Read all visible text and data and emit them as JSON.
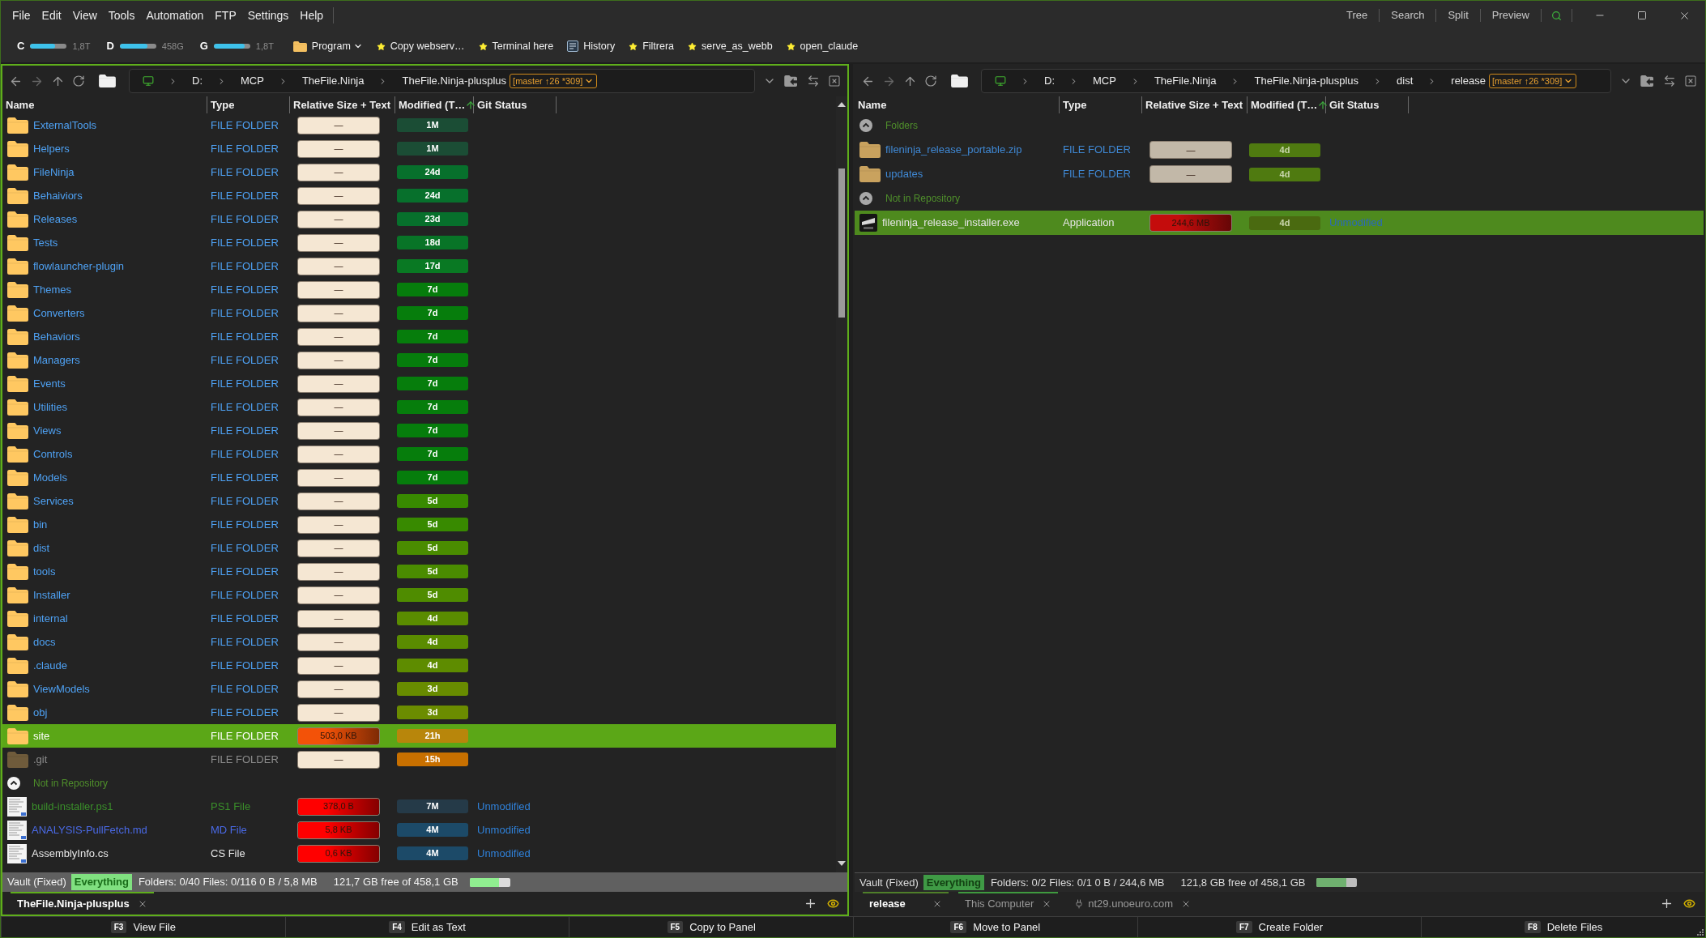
{
  "menu": [
    "File",
    "Edit",
    "View",
    "Tools",
    "Automation",
    "FTP",
    "Settings",
    "Help"
  ],
  "view_buttons": [
    "Tree",
    "Search",
    "Split",
    "Preview"
  ],
  "drives": [
    {
      "letter": "C",
      "level": 0.68,
      "capacity": "1,8T"
    },
    {
      "letter": "D",
      "level": 0.77,
      "capacity": "458G"
    },
    {
      "letter": "G",
      "level": 0.85,
      "capacity": "1,8T"
    }
  ],
  "quick_actions": [
    {
      "kind": "folder",
      "label": "Program",
      "dropdown": true
    },
    {
      "kind": "star",
      "label": "Copy webserv…",
      "dropdown": false
    },
    {
      "kind": "star",
      "label": "Terminal here",
      "dropdown": false
    },
    {
      "kind": "window",
      "label": "History",
      "dropdown": false
    },
    {
      "kind": "star",
      "label": "Filtrera",
      "dropdown": false
    },
    {
      "kind": "star",
      "label": "serve_as_webb",
      "dropdown": false
    },
    {
      "kind": "star",
      "label": "open_claude",
      "dropdown": false
    }
  ],
  "panels": [
    {
      "active": true,
      "scrollable": true,
      "breadcrumb": [
        "D:",
        "MCP",
        "TheFile.Ninja",
        "TheFile.Ninja-plusplus"
      ],
      "git_badge": "[master ↑26 *309]",
      "columns": [
        {
          "label": "Name",
          "sorted": false
        },
        {
          "label": "Type",
          "sorted": false
        },
        {
          "label": "Relative Size + Text",
          "sorted": false
        },
        {
          "label": "Modified (T…",
          "sorted": true
        },
        {
          "label": "Git Status",
          "sorted": false
        }
      ],
      "rows": [
        {
          "kind": "folder",
          "name": "ExternalTools",
          "type": "FILE FOLDER",
          "color": "#4ea1f3",
          "size": {
            "text": "—",
            "color": "#f5e7d3",
            "gradient": false
          },
          "modified": {
            "text": "1M",
            "color": "#1b4d35"
          },
          "selected": false,
          "hidden": false
        },
        {
          "kind": "folder",
          "name": "Helpers",
          "type": "FILE FOLDER",
          "color": "#4ea1f3",
          "size": {
            "text": "—",
            "color": "#f5e7d3",
            "gradient": false
          },
          "modified": {
            "text": "1M",
            "color": "#1b4d35"
          },
          "selected": false,
          "hidden": false
        },
        {
          "kind": "folder",
          "name": "FileNinja",
          "type": "FILE FOLDER",
          "color": "#4ea1f3",
          "size": {
            "text": "—",
            "color": "#f5e7d3",
            "gradient": false
          },
          "modified": {
            "text": "24d",
            "color": "#07702c"
          },
          "selected": false,
          "hidden": false
        },
        {
          "kind": "folder",
          "name": "Behaiviors",
          "type": "FILE FOLDER",
          "color": "#4ea1f3",
          "size": {
            "text": "—",
            "color": "#f5e7d3",
            "gradient": false
          },
          "modified": {
            "text": "24d",
            "color": "#07702c"
          },
          "selected": false,
          "hidden": false
        },
        {
          "kind": "folder",
          "name": "Releases",
          "type": "FILE FOLDER",
          "color": "#4ea1f3",
          "size": {
            "text": "—",
            "color": "#f5e7d3",
            "gradient": false
          },
          "modified": {
            "text": "23d",
            "color": "#07702c"
          },
          "selected": false,
          "hidden": false
        },
        {
          "kind": "folder",
          "name": "Tests",
          "type": "FILE FOLDER",
          "color": "#4ea1f3",
          "size": {
            "text": "—",
            "color": "#f5e7d3",
            "gradient": false
          },
          "modified": {
            "text": "18d",
            "color": "#087427"
          },
          "selected": false,
          "hidden": false
        },
        {
          "kind": "folder",
          "name": "flowlauncher-plugin",
          "type": "FILE FOLDER",
          "color": "#4ea1f3",
          "size": {
            "text": "—",
            "color": "#f5e7d3",
            "gradient": false
          },
          "modified": {
            "text": "17d",
            "color": "#097923"
          },
          "selected": false,
          "hidden": false
        },
        {
          "kind": "folder",
          "name": "Themes",
          "type": "FILE FOLDER",
          "color": "#4ea1f3",
          "size": {
            "text": "—",
            "color": "#f5e7d3",
            "gradient": false
          },
          "modified": {
            "text": "7d",
            "color": "#067d0c"
          },
          "selected": false,
          "hidden": false
        },
        {
          "kind": "folder",
          "name": "Converters",
          "type": "FILE FOLDER",
          "color": "#4ea1f3",
          "size": {
            "text": "—",
            "color": "#f5e7d3",
            "gradient": false
          },
          "modified": {
            "text": "7d",
            "color": "#067d0c"
          },
          "selected": false,
          "hidden": false
        },
        {
          "kind": "folder",
          "name": "Behaviors",
          "type": "FILE FOLDER",
          "color": "#4ea1f3",
          "size": {
            "text": "—",
            "color": "#f5e7d3",
            "gradient": false
          },
          "modified": {
            "text": "7d",
            "color": "#067d0c"
          },
          "selected": false,
          "hidden": false
        },
        {
          "kind": "folder",
          "name": "Managers",
          "type": "FILE FOLDER",
          "color": "#4ea1f3",
          "size": {
            "text": "—",
            "color": "#f5e7d3",
            "gradient": false
          },
          "modified": {
            "text": "7d",
            "color": "#067d0c"
          },
          "selected": false,
          "hidden": false
        },
        {
          "kind": "folder",
          "name": "Events",
          "type": "FILE FOLDER",
          "color": "#4ea1f3",
          "size": {
            "text": "—",
            "color": "#f5e7d3",
            "gradient": false
          },
          "modified": {
            "text": "7d",
            "color": "#067d0c"
          },
          "selected": false,
          "hidden": false
        },
        {
          "kind": "folder",
          "name": "Utilities",
          "type": "FILE FOLDER",
          "color": "#4ea1f3",
          "size": {
            "text": "—",
            "color": "#f5e7d3",
            "gradient": false
          },
          "modified": {
            "text": "7d",
            "color": "#067d0c"
          },
          "selected": false,
          "hidden": false
        },
        {
          "kind": "folder",
          "name": "Views",
          "type": "FILE FOLDER",
          "color": "#4ea1f3",
          "size": {
            "text": "—",
            "color": "#f5e7d3",
            "gradient": false
          },
          "modified": {
            "text": "7d",
            "color": "#067d0c"
          },
          "selected": false,
          "hidden": false
        },
        {
          "kind": "folder",
          "name": "Controls",
          "type": "FILE FOLDER",
          "color": "#4ea1f3",
          "size": {
            "text": "—",
            "color": "#f5e7d3",
            "gradient": false
          },
          "modified": {
            "text": "7d",
            "color": "#067d0c"
          },
          "selected": false,
          "hidden": false
        },
        {
          "kind": "folder",
          "name": "Models",
          "type": "FILE FOLDER",
          "color": "#4ea1f3",
          "size": {
            "text": "—",
            "color": "#f5e7d3",
            "gradient": false
          },
          "modified": {
            "text": "7d",
            "color": "#067d0c"
          },
          "selected": false,
          "hidden": false
        },
        {
          "kind": "folder",
          "name": "Services",
          "type": "FILE FOLDER",
          "color": "#4ea1f3",
          "size": {
            "text": "—",
            "color": "#f5e7d3",
            "gradient": false
          },
          "modified": {
            "text": "5d",
            "color": "#388a00"
          },
          "selected": false,
          "hidden": false
        },
        {
          "kind": "folder",
          "name": "bin",
          "type": "FILE FOLDER",
          "color": "#4ea1f3",
          "size": {
            "text": "—",
            "color": "#f5e7d3",
            "gradient": false
          },
          "modified": {
            "text": "5d",
            "color": "#388a00"
          },
          "selected": false,
          "hidden": false
        },
        {
          "kind": "folder",
          "name": "dist",
          "type": "FILE FOLDER",
          "color": "#4ea1f3",
          "size": {
            "text": "—",
            "color": "#f5e7d3",
            "gradient": false
          },
          "modified": {
            "text": "5d",
            "color": "#4a8c00"
          },
          "selected": false,
          "hidden": false
        },
        {
          "kind": "folder",
          "name": "tools",
          "type": "FILE FOLDER",
          "color": "#4ea1f3",
          "size": {
            "text": "—",
            "color": "#f5e7d3",
            "gradient": false
          },
          "modified": {
            "text": "5d",
            "color": "#4a8c00"
          },
          "selected": false,
          "hidden": false
        },
        {
          "kind": "folder",
          "name": "Installer",
          "type": "FILE FOLDER",
          "color": "#4ea1f3",
          "size": {
            "text": "—",
            "color": "#f5e7d3",
            "gradient": false
          },
          "modified": {
            "text": "5d",
            "color": "#4f8c00"
          },
          "selected": false,
          "hidden": false
        },
        {
          "kind": "folder",
          "name": "internal",
          "type": "FILE FOLDER",
          "color": "#4ea1f3",
          "size": {
            "text": "—",
            "color": "#f5e7d3",
            "gradient": false
          },
          "modified": {
            "text": "4d",
            "color": "#5a8c00"
          },
          "selected": false,
          "hidden": false
        },
        {
          "kind": "folder",
          "name": "docs",
          "type": "FILE FOLDER",
          "color": "#4ea1f3",
          "size": {
            "text": "—",
            "color": "#f5e7d3",
            "gradient": false
          },
          "modified": {
            "text": "4d",
            "color": "#5a8c00"
          },
          "selected": false,
          "hidden": false
        },
        {
          "kind": "folder",
          "name": ".claude",
          "type": "FILE FOLDER",
          "color": "#4ea1f3",
          "size": {
            "text": "—",
            "color": "#f5e7d3",
            "gradient": false
          },
          "modified": {
            "text": "4d",
            "color": "#5e8c00"
          },
          "selected": false,
          "hidden": false
        },
        {
          "kind": "folder",
          "name": "ViewModels",
          "type": "FILE FOLDER",
          "color": "#4ea1f3",
          "size": {
            "text": "—",
            "color": "#f5e7d3",
            "gradient": false
          },
          "modified": {
            "text": "3d",
            "color": "#688c00"
          },
          "selected": false,
          "hidden": false
        },
        {
          "kind": "folder",
          "name": "obj",
          "type": "FILE FOLDER",
          "color": "#4ea1f3",
          "size": {
            "text": "—",
            "color": "#f5e7d3",
            "gradient": false
          },
          "modified": {
            "text": "3d",
            "color": "#6b8c00"
          },
          "selected": false,
          "hidden": false
        },
        {
          "kind": "folder",
          "name": "site",
          "type": "FILE FOLDER",
          "color": "#ffffff",
          "size": {
            "text": "503,0 KB",
            "color": "#f35208",
            "gradient": true
          },
          "modified": {
            "text": "21h",
            "color": "#b8860b"
          },
          "selected": true,
          "hidden": false
        },
        {
          "kind": "folder",
          "name": ".git",
          "type": "FILE FOLDER",
          "color": "#8c8c8c",
          "size": {
            "text": "—",
            "color": "#f5e7d3",
            "gradient": false
          },
          "modified": {
            "text": "15h",
            "color": "#c87000"
          },
          "selected": false,
          "hidden": true
        },
        {
          "kind": "group",
          "label": "Not in Repository",
          "expanded": true
        },
        {
          "kind": "file",
          "name": "build-installer.ps1",
          "type": "PS1 File",
          "color": "#3a8f2a",
          "size": {
            "text": "378,0 B",
            "color": "#ff0000",
            "gradient": true
          },
          "modified": {
            "text": "7M",
            "color": "#253a48"
          },
          "git": "Unmodified",
          "selected": false,
          "hidden": false
        },
        {
          "kind": "file",
          "name": "ANALYSIS-PullFetch.md",
          "type": "MD File",
          "color": "#4a6ae8",
          "size": {
            "text": "5,8 KB",
            "color": "#ff0000",
            "gradient": true
          },
          "modified": {
            "text": "4M",
            "color": "#1c4a68"
          },
          "git": "Unmodified",
          "selected": false,
          "hidden": false
        },
        {
          "kind": "file",
          "name": "AssemblyInfo.cs",
          "type": "CS File",
          "color": "#e8e8e8",
          "size": {
            "text": "0,6 KB",
            "color": "#ff0000",
            "gradient": true
          },
          "modified": {
            "text": "4M",
            "color": "#1c4a68"
          },
          "git": "Unmodified",
          "selected": false,
          "hidden": false
        }
      ],
      "status": {
        "drive": "Vault (Fixed)",
        "index": "Everything",
        "summary": "Folders: 0/40 Files: 0/116 0 B / 5,8 MB",
        "free": "121,7 GB free of 458,1 GB",
        "level": 0.73
      },
      "tabs": [
        {
          "kind": "local",
          "label": "TheFile.Ninja-plusplus",
          "selected": true,
          "color": "#5fae1b"
        }
      ]
    },
    {
      "active": false,
      "scrollable": false,
      "breadcrumb": [
        "D:",
        "MCP",
        "TheFile.Ninja",
        "TheFile.Ninja-plusplus",
        "dist",
        "release"
      ],
      "git_badge": "[master ↑26 *309]",
      "columns": [
        {
          "label": "Name",
          "sorted": false
        },
        {
          "label": "Type",
          "sorted": false
        },
        {
          "label": "Relative Size + Text",
          "sorted": false
        },
        {
          "label": "Modified (T…",
          "sorted": true
        },
        {
          "label": "Git Status",
          "sorted": false
        }
      ],
      "rows": [
        {
          "kind": "group",
          "label": "Folders",
          "expanded": true
        },
        {
          "kind": "folder",
          "name": "fileninja_release_portable.zip",
          "type": "FILE FOLDER",
          "color": "#3f88d4",
          "size": {
            "text": "—",
            "color": "#c2b8a8",
            "gradient": false
          },
          "modified": {
            "text": "4d",
            "color": "#4f7a10"
          },
          "selected": false,
          "hidden": false
        },
        {
          "kind": "folder",
          "name": "updates",
          "type": "FILE FOLDER",
          "color": "#3f88d4",
          "size": {
            "text": "—",
            "color": "#c2b8a8",
            "gradient": false
          },
          "modified": {
            "text": "4d",
            "color": "#4f7a10"
          },
          "selected": false,
          "hidden": false
        },
        {
          "kind": "group",
          "label": "Not in Repository",
          "expanded": true
        },
        {
          "kind": "app",
          "name": "fileninja_release_installer.exe",
          "type": "Application",
          "color": "#e4e4e4",
          "size": {
            "text": "244,6 MB",
            "color": "#c40c0c",
            "gradient": true
          },
          "modified": {
            "text": "4d",
            "color": "#4a6a10"
          },
          "git": "Unmodified",
          "selected": true,
          "hidden": false
        }
      ],
      "status": {
        "drive": "Vault (Fixed)",
        "index": "Everything",
        "summary": "Folders: 0/2 Files: 0/1 0 B / 244,6 MB",
        "free": "121,8 GB free of 458,1 GB",
        "level": 0.73
      },
      "tabs": [
        {
          "kind": "local",
          "label": "release",
          "selected": true,
          "color": "#4f7f2a"
        },
        {
          "kind": "local",
          "label": "This Computer",
          "selected": false,
          "color": "#3f9a3f"
        },
        {
          "kind": "remote",
          "label": "nt29.unoeuro.com",
          "selected": false
        }
      ]
    }
  ],
  "function_keys": [
    {
      "key": "F3",
      "label": "View File"
    },
    {
      "key": "F4",
      "label": "Edit as Text"
    },
    {
      "key": "F5",
      "label": "Copy to Panel"
    },
    {
      "key": "F6",
      "label": "Move to Panel"
    },
    {
      "key": "F7",
      "label": "Create Folder"
    },
    {
      "key": "F8",
      "label": "Delete Files"
    }
  ]
}
